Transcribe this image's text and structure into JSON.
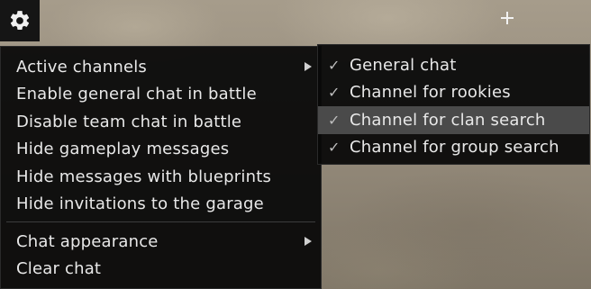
{
  "icons": {
    "settings": "gear-icon",
    "submenu_arrow": "chevron-right-icon",
    "check": "check-icon",
    "crosshair": "crosshair-icon"
  },
  "main_menu": {
    "items": [
      {
        "label": "Active channels"
      },
      {
        "label": "Enable general chat in battle"
      },
      {
        "label": "Disable team chat in battle"
      },
      {
        "label": "Hide gameplay messages"
      },
      {
        "label": "Hide messages with blueprints"
      },
      {
        "label": "Hide invitations to the garage"
      },
      {
        "label": "Chat appearance"
      },
      {
        "label": "Clear chat"
      }
    ]
  },
  "channels_submenu": {
    "items": [
      {
        "label": "General chat",
        "checked": true
      },
      {
        "label": "Channel for rookies",
        "checked": true
      },
      {
        "label": "Channel for clan search",
        "checked": true,
        "highlighted": true
      },
      {
        "label": "Channel for group search",
        "checked": true
      }
    ],
    "check_glyph": "✓"
  },
  "colors": {
    "menu_bg": "#080808",
    "highlight": "#4a4a4a",
    "text": "#e8e8e8"
  }
}
